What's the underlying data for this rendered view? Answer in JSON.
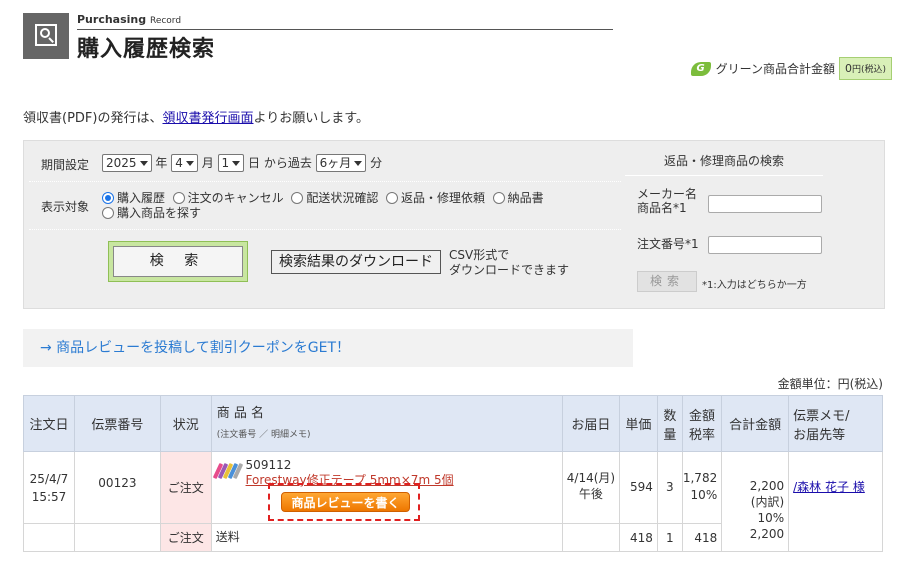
{
  "header": {
    "sub_title": "Purchasing",
    "sub_title_small": "Record",
    "title": "購入履歴検索"
  },
  "green": {
    "leaf": "G",
    "label": "グリーン商品合計金額",
    "amount": "0",
    "unit": "円(税込)"
  },
  "receipt": {
    "prefix": "領収書(PDF)の発行は、",
    "link": "領収書発行画面",
    "suffix": "よりお願いします。"
  },
  "search": {
    "period_label": "期間設定",
    "year": "2025",
    "year_unit": "年",
    "month": "4",
    "month_unit": "月",
    "day": "1",
    "day_unit": "日 から過去",
    "range": "6ヶ月",
    "range_unit": "分",
    "target_label": "表示対象",
    "radios": [
      "購入履歴",
      "注文のキャンセル",
      "配送状況確認",
      "返品・修理依頼",
      "納品書",
      "購入商品を探す"
    ],
    "search_btn": "検 索",
    "download_btn": "検索結果のダウンロード",
    "download_note_1": "CSV形式で",
    "download_note_2": "ダウンロードできます"
  },
  "return_search": {
    "title": "返品・修理商品の検索",
    "maker_label_1": "メーカー名",
    "maker_label_2": "商品名*1",
    "order_label": "注文番号*1",
    "button": "検索",
    "note": "*1:入力はどちらか一方"
  },
  "coupon": {
    "text": "→ 商品レビューを投稿して割引クーポンをGET！"
  },
  "unit_label": "金額単位：円(税込)",
  "table": {
    "headers": {
      "date": "注文日",
      "slip": "伝票番号",
      "status": "状況",
      "name": "商 品 名",
      "name_sub": "(注文番号 ／ 明細メモ)",
      "delivery": "お届日",
      "price": "単価",
      "qty_1": "数",
      "qty_2": "量",
      "amount_1": "金額",
      "amount_2": "税率",
      "total": "合計金額",
      "memo_1": "伝票メモ/",
      "memo_2": "お届先等"
    },
    "row": {
      "date_1": "25/4/7",
      "date_2": "15:57",
      "slip": "00123",
      "status": "ご注文",
      "code": "509112",
      "product": "Forestway修正テープ 5mm×7m 5個",
      "review_btn": "商品レビューを書く",
      "delivery_1": "4/14(月)",
      "delivery_2": "午後",
      "price": "594",
      "qty": "3",
      "amount": "1,782",
      "tax": "10%",
      "total": "2,200",
      "total_breakdown": "(内訳)",
      "total_tax": "10%",
      "total_sub": "2,200",
      "memo": "/森林 花子 様"
    },
    "shipping": {
      "status": "ご注文",
      "name": "送料",
      "price": "418",
      "qty": "1",
      "amount": "418"
    }
  }
}
